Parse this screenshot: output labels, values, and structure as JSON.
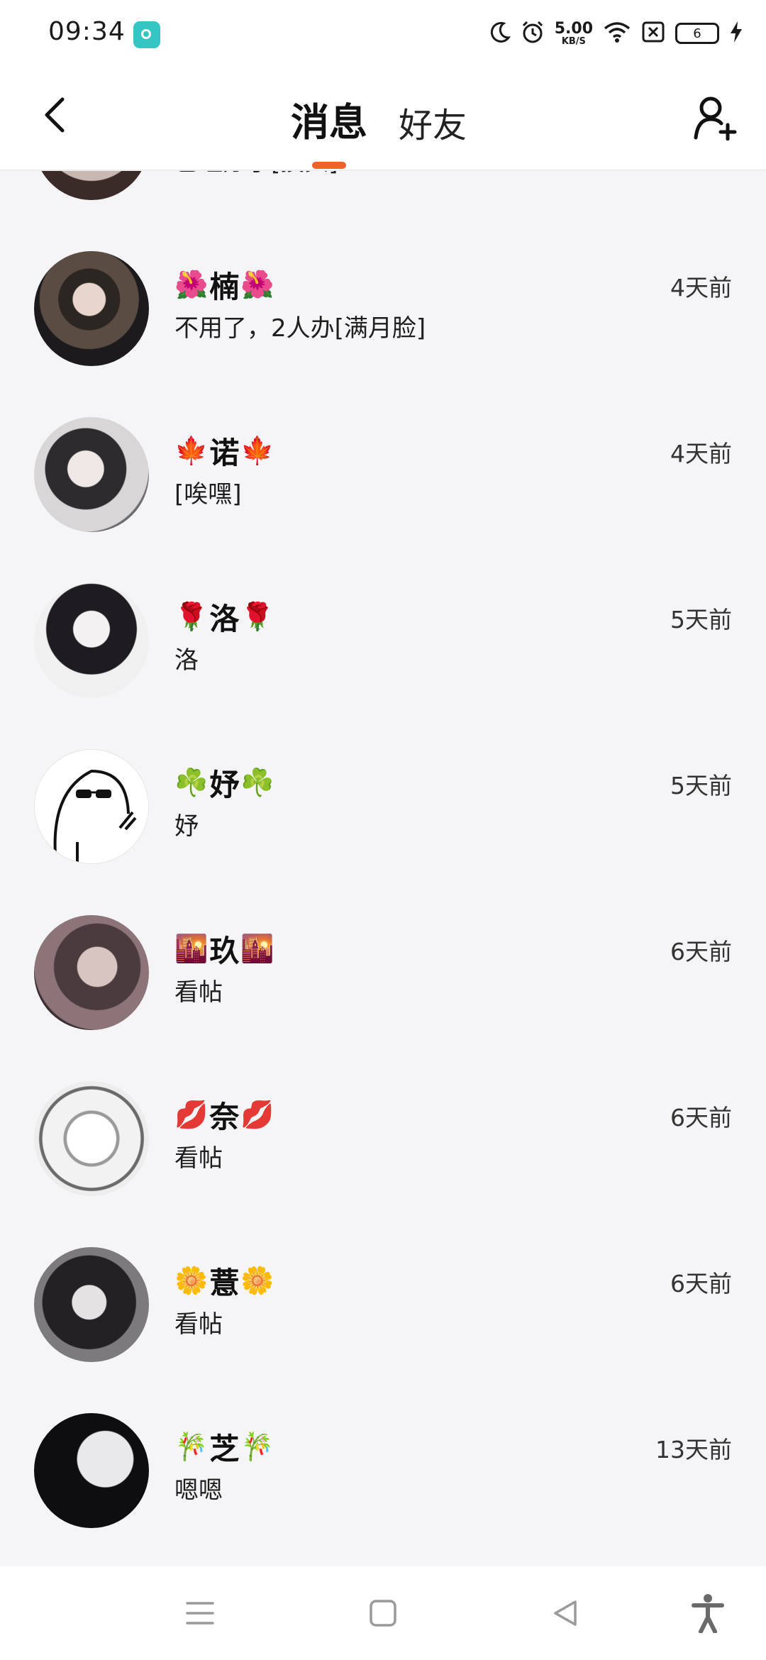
{
  "status_bar": {
    "time": "09:34",
    "net_speed_value": "5.00",
    "net_speed_unit": "KB/S",
    "battery_level": "6"
  },
  "header": {
    "tab_messages": "消息",
    "tab_friends": "好友"
  },
  "conversations": [
    {
      "name": "",
      "deco": "",
      "preview": "已经办了[摸头]",
      "time": ""
    },
    {
      "name": "楠",
      "deco": "🌺",
      "preview": "不用了，2人办[满月脸]",
      "time": "4天前"
    },
    {
      "name": "诺",
      "deco": "🍁",
      "preview": "[唉嘿]",
      "time": "4天前"
    },
    {
      "name": "洛",
      "deco": "🌹",
      "preview": "洛",
      "time": "5天前"
    },
    {
      "name": "妤",
      "deco": "☘️",
      "preview": "妤",
      "time": "5天前"
    },
    {
      "name": "玖",
      "deco": "🌇",
      "preview": "看帖",
      "time": "6天前"
    },
    {
      "name": "奈",
      "deco": "💋",
      "preview": "看帖",
      "time": "6天前"
    },
    {
      "name": "薏",
      "deco": "🌼",
      "preview": "看帖",
      "time": "6天前"
    },
    {
      "name": "芝",
      "deco": "🎋",
      "preview": "嗯嗯",
      "time": "13天前"
    }
  ],
  "icons": {
    "back": "chevron-left-icon",
    "add_friend": "add-user-icon",
    "nav_menu": "menu-icon",
    "nav_home": "home-square-icon",
    "nav_back": "back-triangle-icon",
    "nav_accessibility": "accessibility-icon"
  },
  "colors": {
    "accent": "#f2612a",
    "background": "#f5f5f7"
  }
}
